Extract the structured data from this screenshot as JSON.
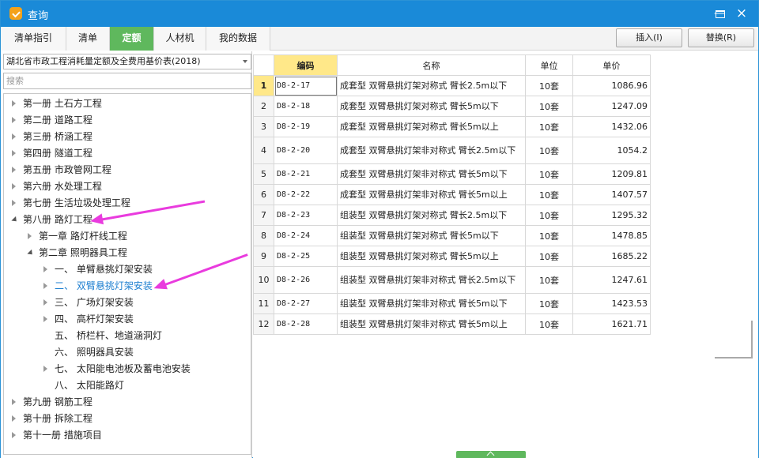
{
  "window": {
    "title": "查询"
  },
  "toolbar": {
    "tabs": [
      "清单指引",
      "清单",
      "定额",
      "人材机",
      "我的数据"
    ],
    "active_tab": "定额",
    "insert_label": "插入(I)",
    "replace_label": "替换(R)"
  },
  "left_panel": {
    "selected_value": "湖北省市政工程消耗量定额及全费用基价表(2018)",
    "search_placeholder": "搜索",
    "tree": [
      "第一册 土石方工程",
      "第二册 道路工程",
      "第三册 桥涵工程",
      "第四册 隧道工程",
      "第五册 市政管网工程",
      "第六册 水处理工程",
      "第七册 生活垃圾处理工程",
      "第八册 路灯工程",
      "第一章 路灯杆线工程",
      "第二章 照明器具工程",
      "一、 单臂悬挑灯架安装",
      "二、 双臂悬挑灯架安装",
      "三、 广场灯架安装",
      "四、 高杆灯架安装",
      "五、 桥栏杆、地道涵洞灯",
      "六、 照明器具安装",
      "七、 太阳能电池板及蓄电池安装",
      "八、 太阳能路灯",
      "第九册 钢筋工程",
      "第十册 拆除工程",
      "第十一册 措施项目"
    ]
  },
  "table": {
    "columns": [
      "编码",
      "名称",
      "单位",
      "单价"
    ],
    "rows": [
      {
        "num": "1",
        "code": "D8-2-17",
        "name": "成套型 双臂悬挑灯架对称式 臂长2.5m以下",
        "unit": "10套",
        "price": "1086.96"
      },
      {
        "num": "2",
        "code": "D8-2-18",
        "name": "成套型 双臂悬挑灯架对称式 臂长5m以下",
        "unit": "10套",
        "price": "1247.09"
      },
      {
        "num": "3",
        "code": "D8-2-19",
        "name": "成套型 双臂悬挑灯架对称式 臂长5m以上",
        "unit": "10套",
        "price": "1432.06"
      },
      {
        "num": "4",
        "code": "D8-2-20",
        "name": "成套型 双臂悬挑灯架非对称式 臂长2.5m以下",
        "unit": "10套",
        "price": "1054.2"
      },
      {
        "num": "5",
        "code": "D8-2-21",
        "name": "成套型 双臂悬挑灯架非对称式 臂长5m以下",
        "unit": "10套",
        "price": "1209.81"
      },
      {
        "num": "6",
        "code": "D8-2-22",
        "name": "成套型 双臂悬挑灯架非对称式 臂长5m以上",
        "unit": "10套",
        "price": "1407.57"
      },
      {
        "num": "7",
        "code": "D8-2-23",
        "name": "组装型 双臂悬挑灯架对称式 臂长2.5m以下",
        "unit": "10套",
        "price": "1295.32"
      },
      {
        "num": "8",
        "code": "D8-2-24",
        "name": "组装型 双臂悬挑灯架对称式 臂长5m以下",
        "unit": "10套",
        "price": "1478.85"
      },
      {
        "num": "9",
        "code": "D8-2-25",
        "name": "组装型 双臂悬挑灯架对称式 臂长5m以上",
        "unit": "10套",
        "price": "1685.22"
      },
      {
        "num": "10",
        "code": "D8-2-26",
        "name": "组装型 双臂悬挑灯架非对称式 臂长2.5m以下",
        "unit": "10套",
        "price": "1247.61"
      },
      {
        "num": "11",
        "code": "D8-2-27",
        "name": "组装型 双臂悬挑灯架非对称式 臂长5m以下",
        "unit": "10套",
        "price": "1423.53"
      },
      {
        "num": "12",
        "code": "D8-2-28",
        "name": "组装型 双臂悬挑灯架非对称式 臂长5m以上",
        "unit": "10套",
        "price": "1621.71"
      }
    ]
  },
  "colors": {
    "titlebar": "#1a8ad8",
    "active_tab": "#5fb85d",
    "column_highlight": "#ffe889",
    "selected_tree_item": "#1d7fd0",
    "annotation_arrow": "#e93bde"
  },
  "icons": {
    "app": "app-icon",
    "minimize": "minimize-icon",
    "maximize": "maximize-icon",
    "close": "close-icon"
  }
}
